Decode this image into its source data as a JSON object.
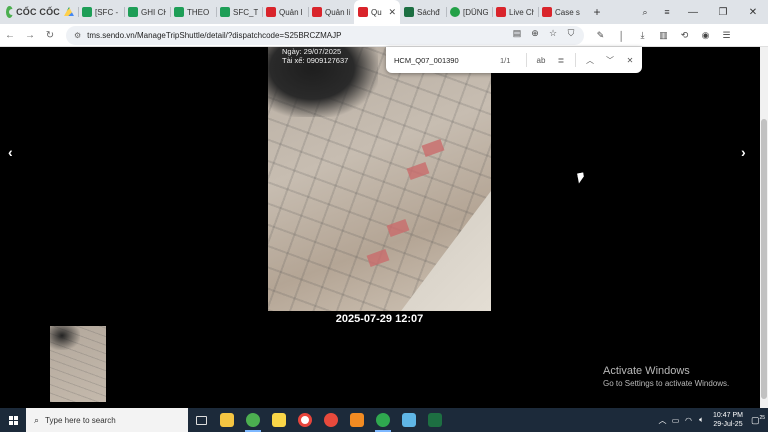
{
  "browser": {
    "brand": "CỐC CỐC",
    "tabs": [
      {
        "label": "",
        "icon": "drive",
        "close": false,
        "active": false
      },
      {
        "label": "[SFC - ",
        "icon": "sheets",
        "close": false,
        "active": false
      },
      {
        "label": "GHI CH",
        "icon": "sheets",
        "close": false,
        "active": false
      },
      {
        "label": "THEO D",
        "icon": "sheets",
        "close": false,
        "active": false
      },
      {
        "label": "SFC_TH",
        "icon": "sheets",
        "close": false,
        "active": false
      },
      {
        "label": "Quản l",
        "icon": "sendo",
        "close": false,
        "active": false
      },
      {
        "label": "Quản lí",
        "icon": "sendo",
        "close": false,
        "active": false
      },
      {
        "label": "Qu",
        "icon": "sendo",
        "close": true,
        "active": true
      },
      {
        "label": "Sáchđ",
        "icon": "excel",
        "close": false,
        "active": false
      },
      {
        "label": "[DŨNG",
        "icon": "circle",
        "close": false,
        "active": false
      },
      {
        "label": "Live Ch",
        "icon": "sendo",
        "close": false,
        "active": false
      },
      {
        "label": "Case sy",
        "icon": "sendo",
        "close": false,
        "active": false
      }
    ],
    "url": "tms.sendo.vn/ManageTripShuttle/detail/?dispatchcode=S25BRCZMAJP"
  },
  "find_bar": {
    "query": "HCM_Q07_001390",
    "count": "1/1"
  },
  "viewer": {
    "photo_overlay_date": "Ngày: 29/07/2025",
    "photo_overlay_driver": "Tài xế: 0909127637",
    "timestamp": "2025-07-29 12:07",
    "prev_arrow": "‹",
    "next_arrow": "›"
  },
  "watermark": {
    "title": "Activate Windows",
    "subtitle": "Go to Settings to activate Windows."
  },
  "taskbar": {
    "search_placeholder": "Type here to search",
    "time": "10:47 PM",
    "date": "29-Jul-25",
    "notification_count": "25"
  },
  "colors": {
    "accent": "#1e9e57",
    "sendo_red": "#d9242b",
    "taskbar": "#1c2a3a"
  }
}
